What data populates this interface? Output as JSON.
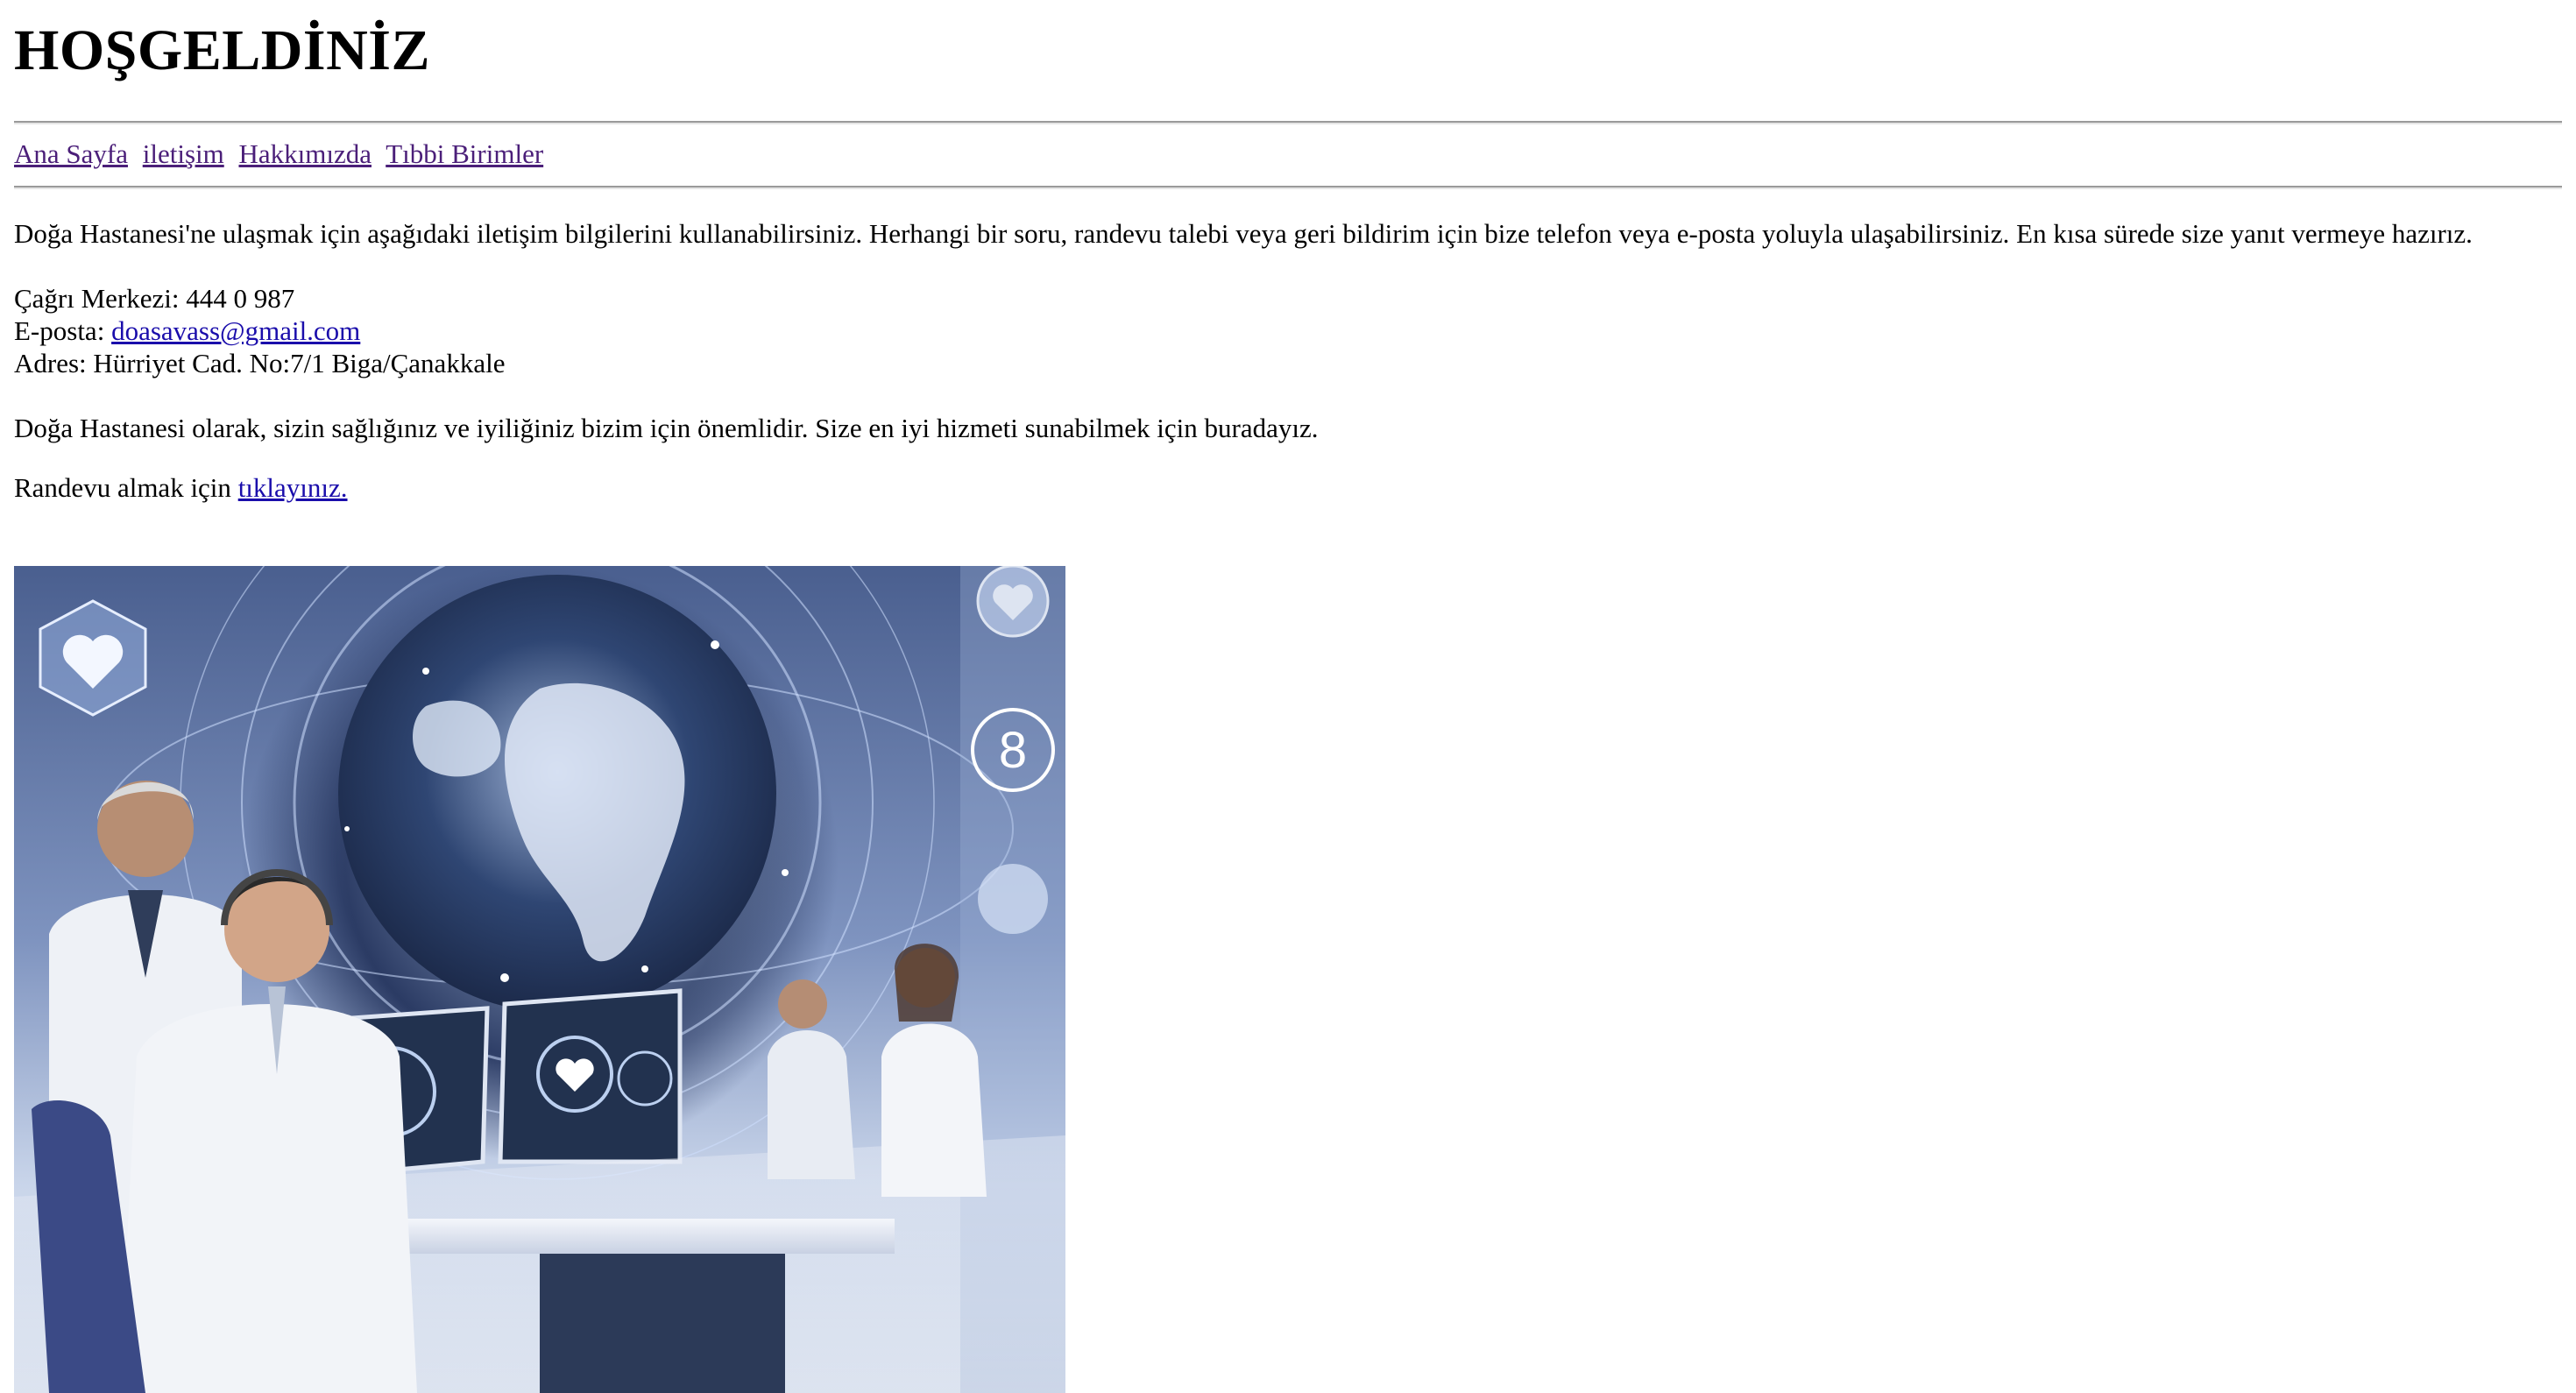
{
  "page": {
    "title": "HOŞGELDİNİZ"
  },
  "nav": {
    "items": [
      {
        "label": "Ana Sayfa"
      },
      {
        "label": "iletişim"
      },
      {
        "label": "Hakkımızda"
      },
      {
        "label": "Tıbbi Birimler"
      }
    ]
  },
  "content": {
    "intro": "Doğa Hastanesi'ne ulaşmak için aşağıdaki iletişim bilgilerini kullanabilirsiniz. Herhangi bir soru, randevu talebi veya geri bildirim için bize telefon veya e-posta yoluyla ulaşabilirsiniz. En kısa sürede size yanıt vermeye hazırız.",
    "call_center": "Çağrı Merkezi: 444 0 987",
    "email_label": "E-posta: ",
    "email": "doasavass@gmail.com",
    "address": "Adres: Hürriyet Cad. No:7/1 Biga/Çanakkale",
    "mission": "Doğa Hastanesi olarak, sizin sağlığınız ve iyiliğiniz bizim için önemlidir. Size en iyi hizmeti sunabilmek için buradayız.",
    "appointment_prefix": "Randevu almak için ",
    "appointment_link": "tıklayınız."
  },
  "colors": {
    "link": "#1a0dab",
    "nav_link_visited": "#4b1f79",
    "rule": "#9a9a9a"
  },
  "hero_image": {
    "description_icons": [
      "globe-icon",
      "heart-icon",
      "doctor-figure",
      "monitor-icon"
    ]
  }
}
